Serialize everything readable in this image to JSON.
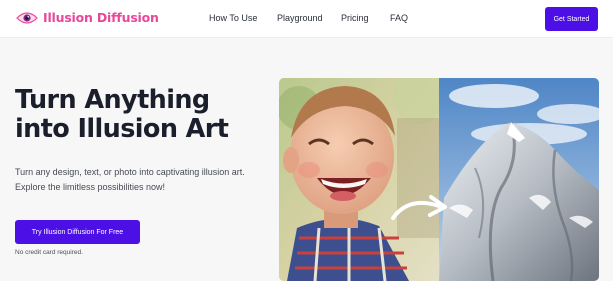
{
  "nav": {
    "brand": "Illusion Diffusion",
    "brand_color": "#e9489a",
    "brand_icon": "eye-icon",
    "links": [
      "How To Use",
      "Playground",
      "Pricing",
      "FAQ"
    ],
    "cta_label": "Get Started"
  },
  "hero": {
    "title_line1": "Turn Anything",
    "title_line2": "into Illusion Art",
    "subtitle": "Turn any design, text, or photo into captivating illusion art. Explore the limitless possibilities now!",
    "button_label": "Try Illusion Diffusion For Free",
    "note": "No credit card required."
  },
  "colors": {
    "accent": "#4c0fe6",
    "page_bg": "#f7f7f8"
  },
  "image": {
    "left_subject": "smiling-child-photo",
    "right_subject": "snowy-mountain-illusion",
    "arrow_icon": "curved-arrow-icon"
  }
}
